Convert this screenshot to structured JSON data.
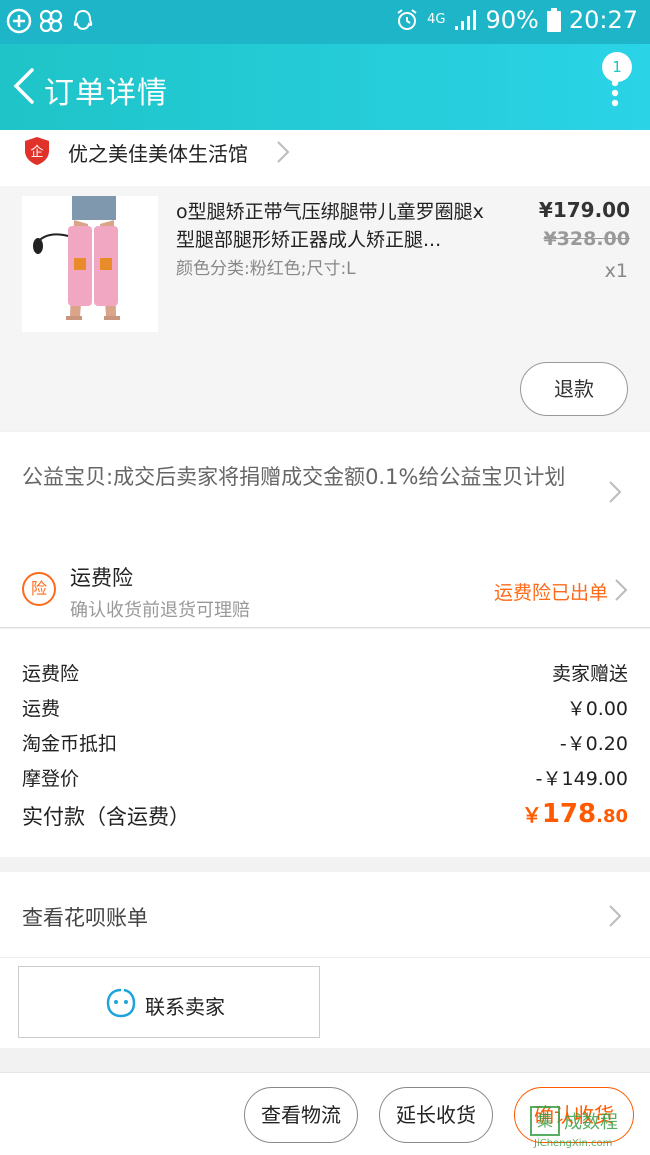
{
  "status_bar": {
    "battery": "90%",
    "time": "20:27",
    "network": "4G",
    "icons": [
      "plus-circle-icon",
      "flower-icon",
      "qq-icon",
      "alarm-icon",
      "signal-icon",
      "battery-icon"
    ]
  },
  "header": {
    "title": "订单详情",
    "badge_count": "1",
    "bg_color": "#1fc4c8"
  },
  "shop": {
    "name": "优之美佳美体生活馆"
  },
  "item": {
    "title": "o型腿矫正带气压绑腿带儿童罗圈腿x型腿部腿形矫正器成人矫正腿...",
    "sku": "颜色分类:粉红色;尺寸:L",
    "price": "¥179.00",
    "original_price": "¥328.00",
    "quantity": "x1",
    "refund_label": "退款"
  },
  "charity": {
    "text": "公益宝贝:成交后卖家将捐赠成交金额0.1%给公益宝贝计划"
  },
  "insurance": {
    "icon_text": "险",
    "title": "运费险",
    "subtitle": "确认收货前退货可理赔",
    "status": "运费险已出单",
    "accent": "#ff6a1a"
  },
  "fees": {
    "rows": [
      {
        "label": "运费险",
        "value": "卖家赠送"
      },
      {
        "label": "运费",
        "value": "￥0.00"
      },
      {
        "label": "淘金币抵扣",
        "value": "-￥0.20"
      },
      {
        "label": "摩登价",
        "value": "-￥149.00"
      }
    ],
    "total_label": "实付款（含运费）",
    "total_currency": "￥",
    "total_integer": "178",
    "total_decimal": ".80",
    "total_color": "#ff5a00"
  },
  "huabei": {
    "label": "查看花呗账单"
  },
  "contact": {
    "label": "联系卖家"
  },
  "actions": {
    "logistics": "查看物流",
    "extend": "延长收货",
    "confirm": "确认收货"
  },
  "watermark": {
    "char": "集",
    "text": "成数程",
    "url": "JiChengXin.com"
  }
}
